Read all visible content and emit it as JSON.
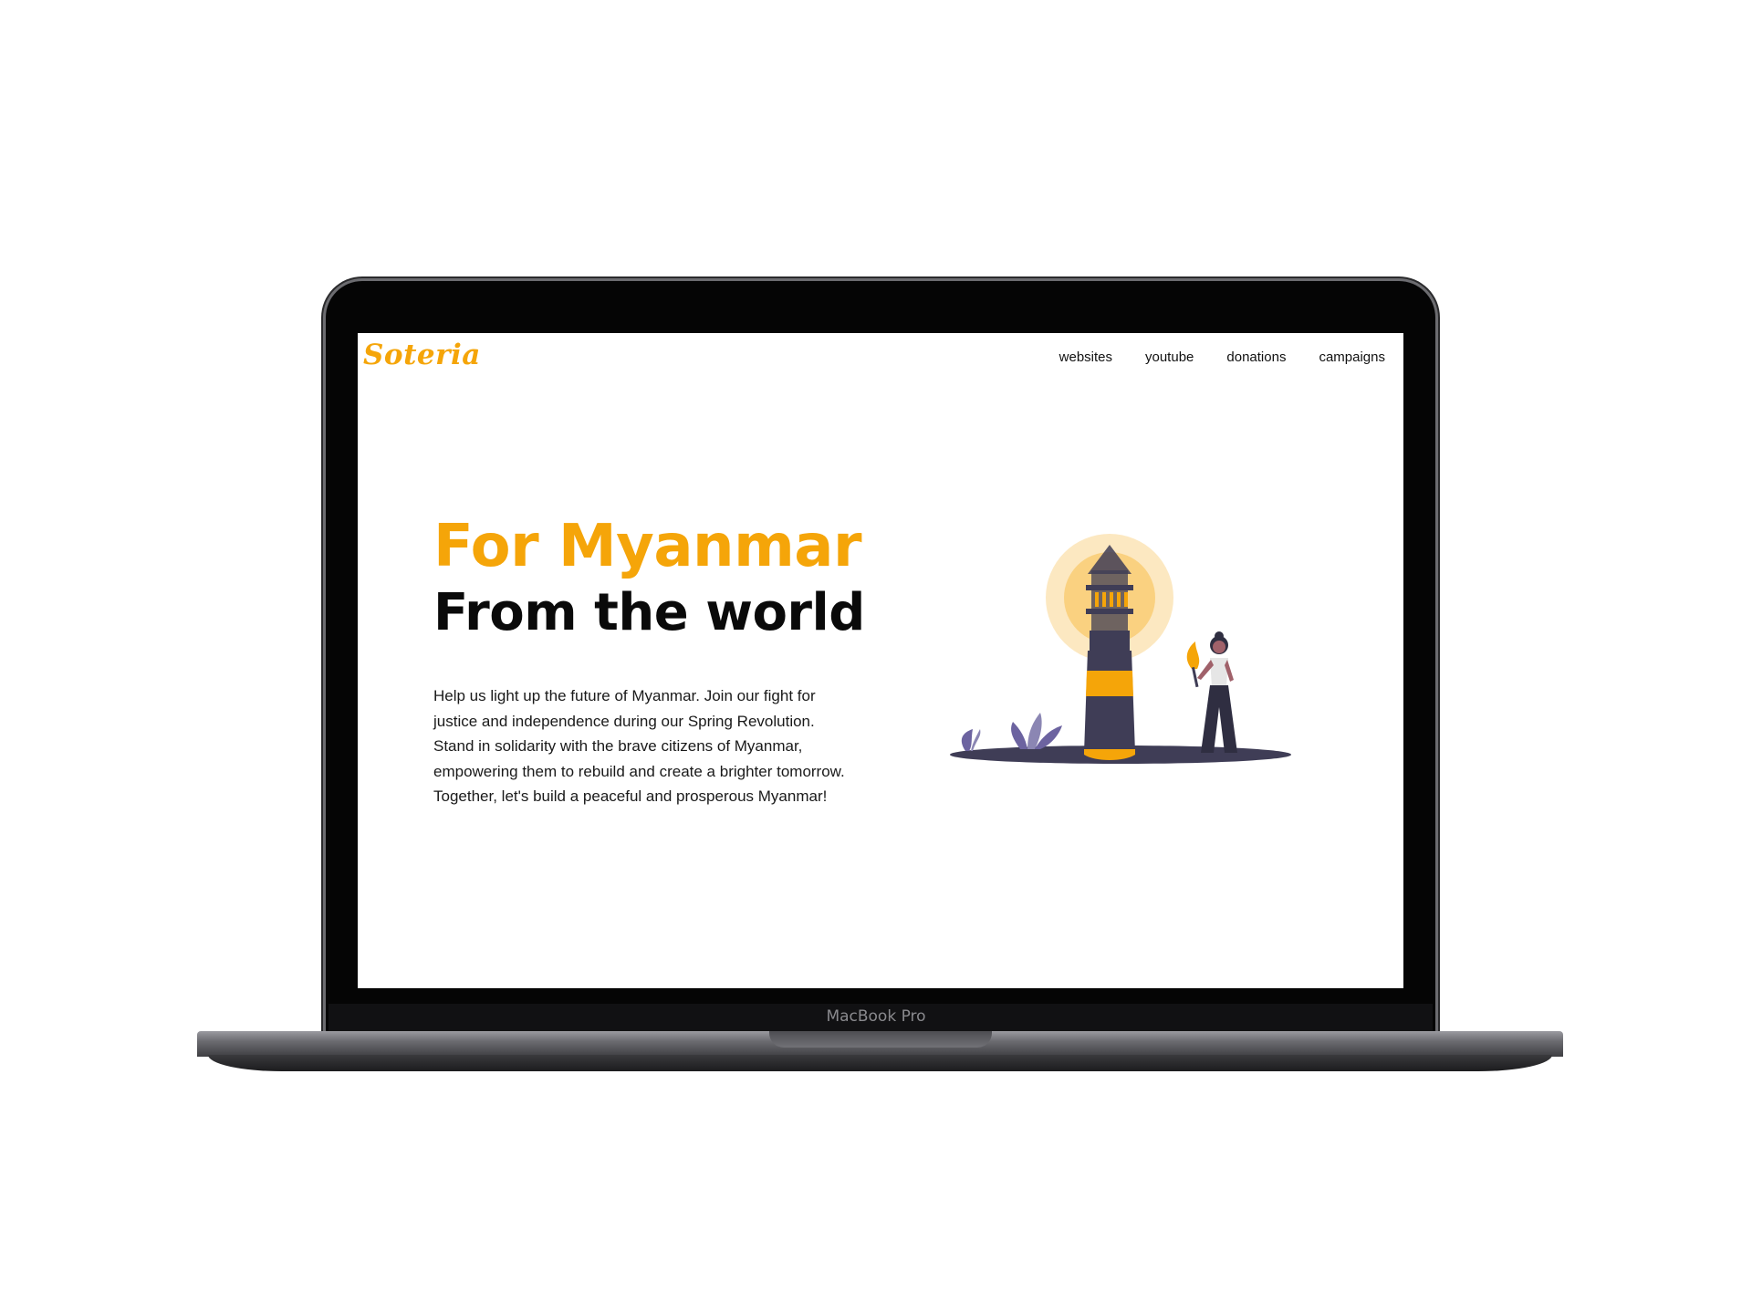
{
  "device": {
    "label": "MacBook Pro"
  },
  "site": {
    "logo": "Soteria",
    "nav": [
      {
        "label": "websites"
      },
      {
        "label": "youtube"
      },
      {
        "label": "donations"
      },
      {
        "label": "campaigns"
      }
    ],
    "hero": {
      "title_line1": "For Myanmar",
      "title_line2": "From the world",
      "body_lines": [
        "Help us light up the future of Myanmar. Join our fight for",
        "justice and independence during our Spring Revolution.",
        "Stand in solidarity with the brave citizens of Myanmar,",
        "empowering them to rebuild and create a brighter tomorrow.",
        "Together, let's build a peaceful and prosperous Myanmar!"
      ]
    },
    "illustration": {
      "icons": [
        "lighthouse-icon",
        "woman-with-torch-icon",
        "plant-icon"
      ]
    }
  },
  "colors": {
    "accent": "#f5a509",
    "dark": "#3f3d56",
    "text": "#0a0a0a"
  }
}
